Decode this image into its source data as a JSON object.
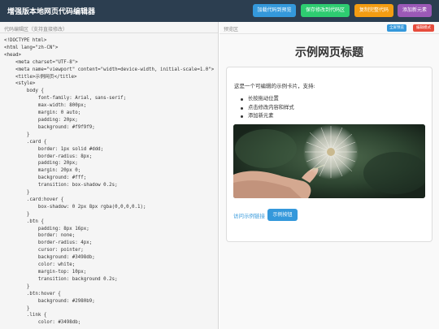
{
  "app": {
    "title": "增强版本地网页代码编辑器"
  },
  "toolbar": {
    "load_label": "加载代码到预览",
    "save_label": "保存修改到代码区",
    "copy_label": "复制完整代码",
    "add_label": "添加新元素"
  },
  "editor": {
    "label": "代码编辑区（支持直接修改）",
    "code": "<!DOCTYPE html>\n<html lang=\"zh-CN\">\n<head>\n    <meta charset=\"UTF-8\">\n    <meta name=\"viewport\" content=\"width=device-width, initial-scale=1.0\">\n    <title>示例网页</title>\n    <style>\n        body {\n            font-family: Arial, sans-serif;\n            max-width: 800px;\n            margin: 0 auto;\n            padding: 20px;\n            background: #f9f9f9;\n        }\n        .card {\n            border: 1px solid #ddd;\n            border-radius: 8px;\n            padding: 20px;\n            margin: 20px 0;\n            background: #fff;\n            transition: box-shadow 0.2s;\n        }\n        .card:hover {\n            box-shadow: 0 2px 8px rgba(0,0,0,0.1);\n        }\n        .btn {\n            padding: 8px 16px;\n            border: none;\n            border-radius: 4px;\n            cursor: pointer;\n            background: #3498db;\n            color: white;\n            margin-top: 10px;\n            transition: background 0.2s;\n        }\n        .btn:hover {\n            background: #2980b9;\n        }\n        .link {\n            color: #3498db;"
  },
  "preview": {
    "label": "预览区",
    "fullscreen_label": "全屏预览",
    "edit_mode_label": "编辑模式",
    "heading": "示例网页标题",
    "card": {
      "intro": "这是一个可编辑的示例卡片，支持:",
      "features": [
        "长按拖动位置",
        "点击修改内容和样式",
        "添加新元素"
      ],
      "link_text": "访问示例链接",
      "button_label": "示例按钮"
    }
  },
  "colors": {
    "topbar": "#2c3e50",
    "load": "#3498db",
    "save": "#2ecc71",
    "copy": "#f39c12",
    "add": "#9b59b6",
    "fullscreen": "#3498db",
    "edit_mode": "#e74c3c"
  }
}
